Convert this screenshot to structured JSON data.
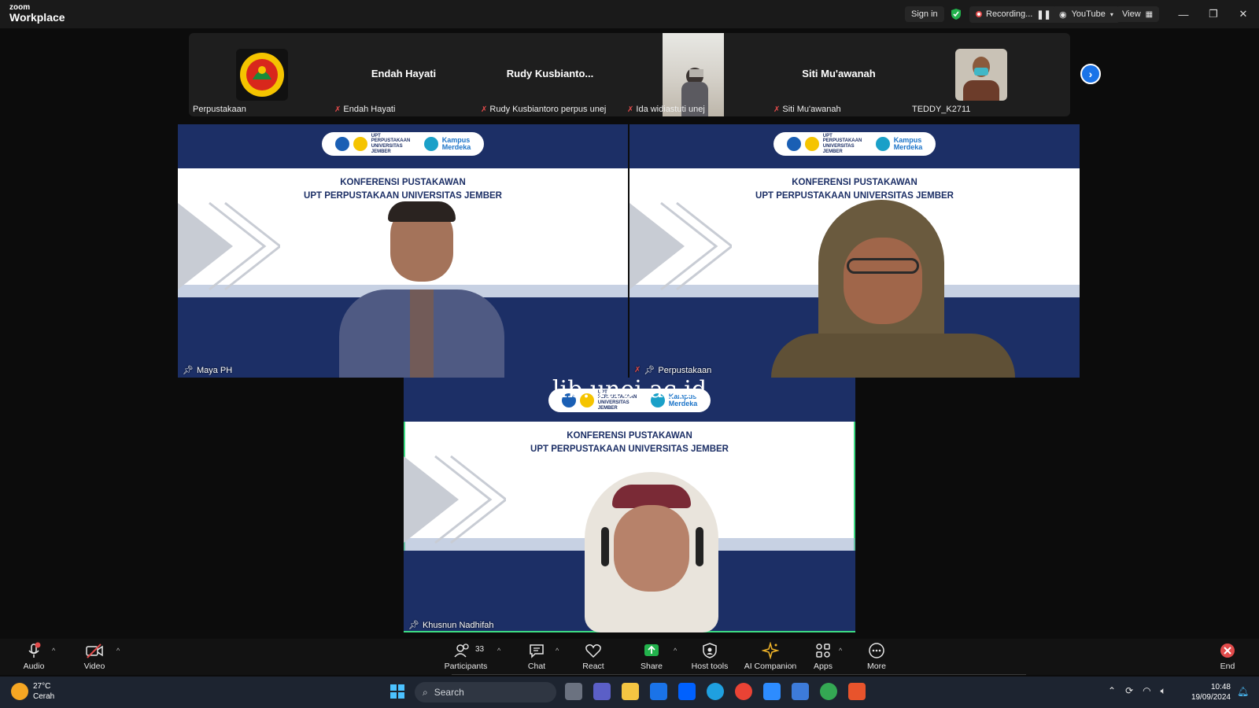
{
  "app": {
    "logo_top": "zoom",
    "logo_bottom": "Workplace"
  },
  "titlebar": {
    "sign_in": "Sign in",
    "recording": "Recording...",
    "stream": "YouTube",
    "view": "View"
  },
  "filmstrip": [
    {
      "label": "Perpustakaan"
    },
    {
      "big_name": "Endah Hayati",
      "label": "Endah Hayati"
    },
    {
      "big_name": "Rudy  Kusbianto...",
      "label": "Rudy Kusbiantoro perpus unej"
    },
    {
      "label": "Ida widiastuti unej"
    },
    {
      "big_name": "Siti Mu'awanah",
      "label": "Siti Mu'awanah"
    },
    {
      "label": "TEDDY_K2711"
    }
  ],
  "slide": {
    "logo_text": "UPT PERPUSTAKAAN UNIVERSITAS JEMBER",
    "kampus_top": "Kampus",
    "kampus_bottom": "Merdeka",
    "conf_line1": "KONFERENSI PUSTAKAWAN",
    "conf_line2": "UPT PERPUSTAKAAN UNIVERSITAS JEMBER"
  },
  "videos": [
    {
      "label": "Maya PH"
    },
    {
      "label": "Perpustakaan"
    },
    {
      "label": "Khusnun Nadhifah",
      "overlay": "lib.unej.ac.id"
    }
  ],
  "toolbar": {
    "audio": "Audio",
    "video": "Video",
    "participants": "Participants",
    "participants_count": "33",
    "chat": "Chat",
    "react": "React",
    "share": "Share",
    "host_tools": "Host tools",
    "ai_companion": "AI Companion",
    "apps": "Apps",
    "more": "More",
    "end": "End"
  },
  "taskbar": {
    "weather_temp": "27°C",
    "weather_desc": "Cerah",
    "search_placeholder": "Search",
    "time": "10:48",
    "date": "19/09/2024"
  },
  "colors": {
    "slide_navy": "#1c2f66",
    "active_speaker": "#3ddc84",
    "zoom_blue": "#1a73e8",
    "share_green": "#22b24c",
    "end_red": "#e24b4b"
  }
}
